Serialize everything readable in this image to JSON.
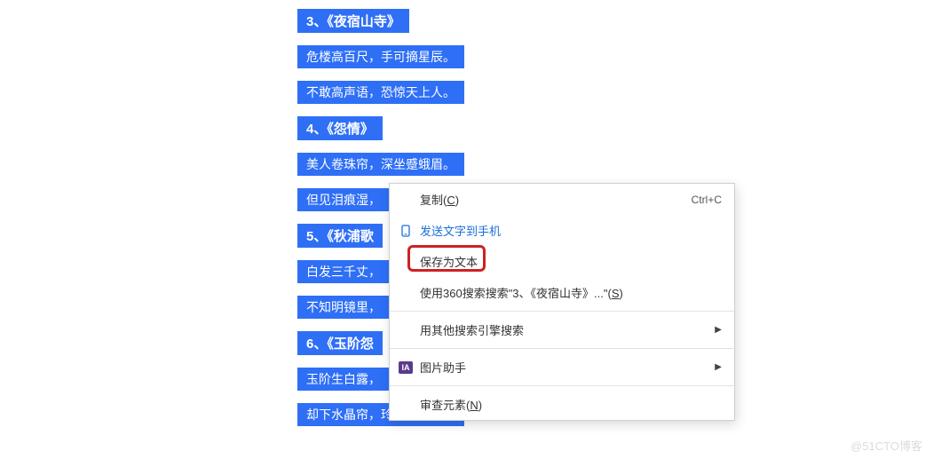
{
  "lines": [
    {
      "text": "3、《夜宿山寺》",
      "heading": true
    },
    {
      "text": "危楼高百尺，手可摘星辰。",
      "heading": false
    },
    {
      "text": "不敢高声语，恐惊天上人。",
      "heading": false
    },
    {
      "text": "4、《怨情》",
      "heading": true
    },
    {
      "text": "美人卷珠帘，深坐蹙蛾眉。",
      "heading": false
    },
    {
      "text": "但见泪痕湿，",
      "heading": false
    },
    {
      "text": "5、《秋浦歌",
      "heading": true
    },
    {
      "text": "白发三千丈，",
      "heading": false
    },
    {
      "text": "不知明镜里，",
      "heading": false
    },
    {
      "text": "6、《玉阶怨",
      "heading": true
    },
    {
      "text": "玉阶生白露，",
      "heading": false
    },
    {
      "text": "却下水晶帘，玲珑望秋月。",
      "heading": false
    }
  ],
  "menu": {
    "copy": {
      "label": "复制",
      "key": "C",
      "shortcut": "Ctrl+C"
    },
    "sendPhone": {
      "label": "发送文字到手机"
    },
    "saveText": {
      "label": "保存为文本"
    },
    "search360": {
      "prefix": "使用360搜索搜索\"3、《夜宿山寺》...\"(",
      "key": "S",
      "suffix": ")"
    },
    "otherEngine": {
      "label": "用其他搜索引擎搜索"
    },
    "imageHelper": {
      "label": "图片助手",
      "iconText": "IA"
    },
    "inspect": {
      "label": "审查元素(",
      "key": "N",
      "suffix": ")"
    }
  },
  "watermark": "@51CTO博客"
}
